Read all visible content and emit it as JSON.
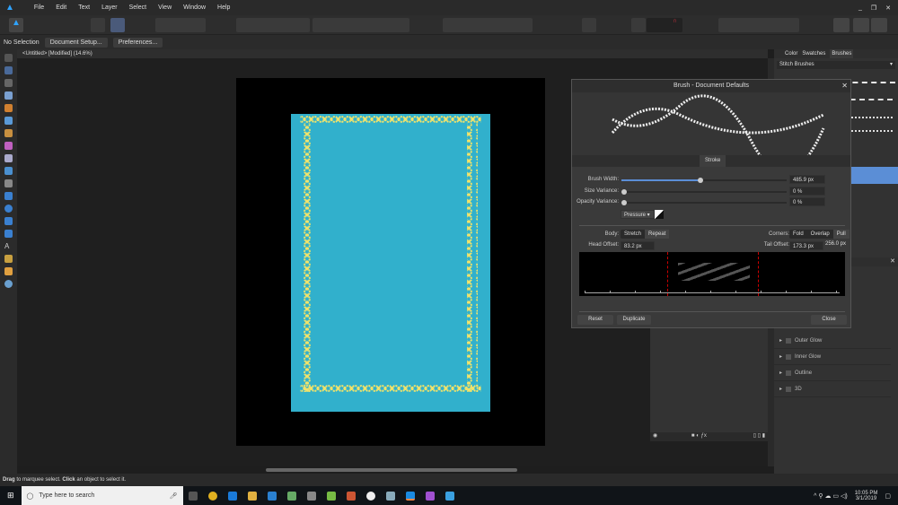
{
  "menu": [
    "File",
    "Edit",
    "Text",
    "Layer",
    "Select",
    "View",
    "Window",
    "Help"
  ],
  "context": {
    "selection": "No Selection",
    "document_setup": "Document Setup...",
    "preferences": "Preferences..."
  },
  "doc_tab": "<Untitled> [Modified] (14.6%)",
  "canvas": {
    "page_color": "#000000",
    "artboard_color": "#31b0cc",
    "stitch_color": "#f2e36a"
  },
  "right_panel": {
    "tabs": [
      "Color",
      "Swatches",
      "Brushes"
    ],
    "active_tab": "Brushes",
    "category": "Stitch Brushes",
    "effects": [
      "Outer Glow",
      "Inner Glow",
      "Outline",
      "3D"
    ]
  },
  "dialog": {
    "title": "Brush - Document Defaults",
    "tab": "Stroke",
    "brush_width_label": "Brush Width:",
    "brush_width": "485.9 px",
    "brush_width_fraction": 0.48,
    "size_variance_label": "Size Variance:",
    "size_variance": "0 %",
    "opacity_variance_label": "Opacity Variance:",
    "opacity_variance": "0 %",
    "pressure": "Pressure",
    "body_label": "Body:",
    "body_options": [
      "Stretch",
      "Repeat"
    ],
    "body_selected": "Repeat",
    "corners_label": "Corners:",
    "corner_options": [
      "Fold",
      "Overlap",
      "Pull"
    ],
    "corner_selected": "Pull",
    "head_offset_label": "Head Offset:",
    "head_offset": "83.2 px",
    "tail_offset_label": "Tail Offset:",
    "tail_offset": "173.3 px",
    "total_length": "256.0 px",
    "reset": "Reset",
    "duplicate": "Duplicate",
    "close": "Close"
  },
  "status": {
    "bold1": "Drag",
    "text1": " to marquee select. ",
    "bold2": "Click",
    "text2": " an object to select it."
  },
  "taskbar": {
    "search_placeholder": "Type here to search",
    "time": "10:05 PM",
    "date": "3/1/2019"
  }
}
